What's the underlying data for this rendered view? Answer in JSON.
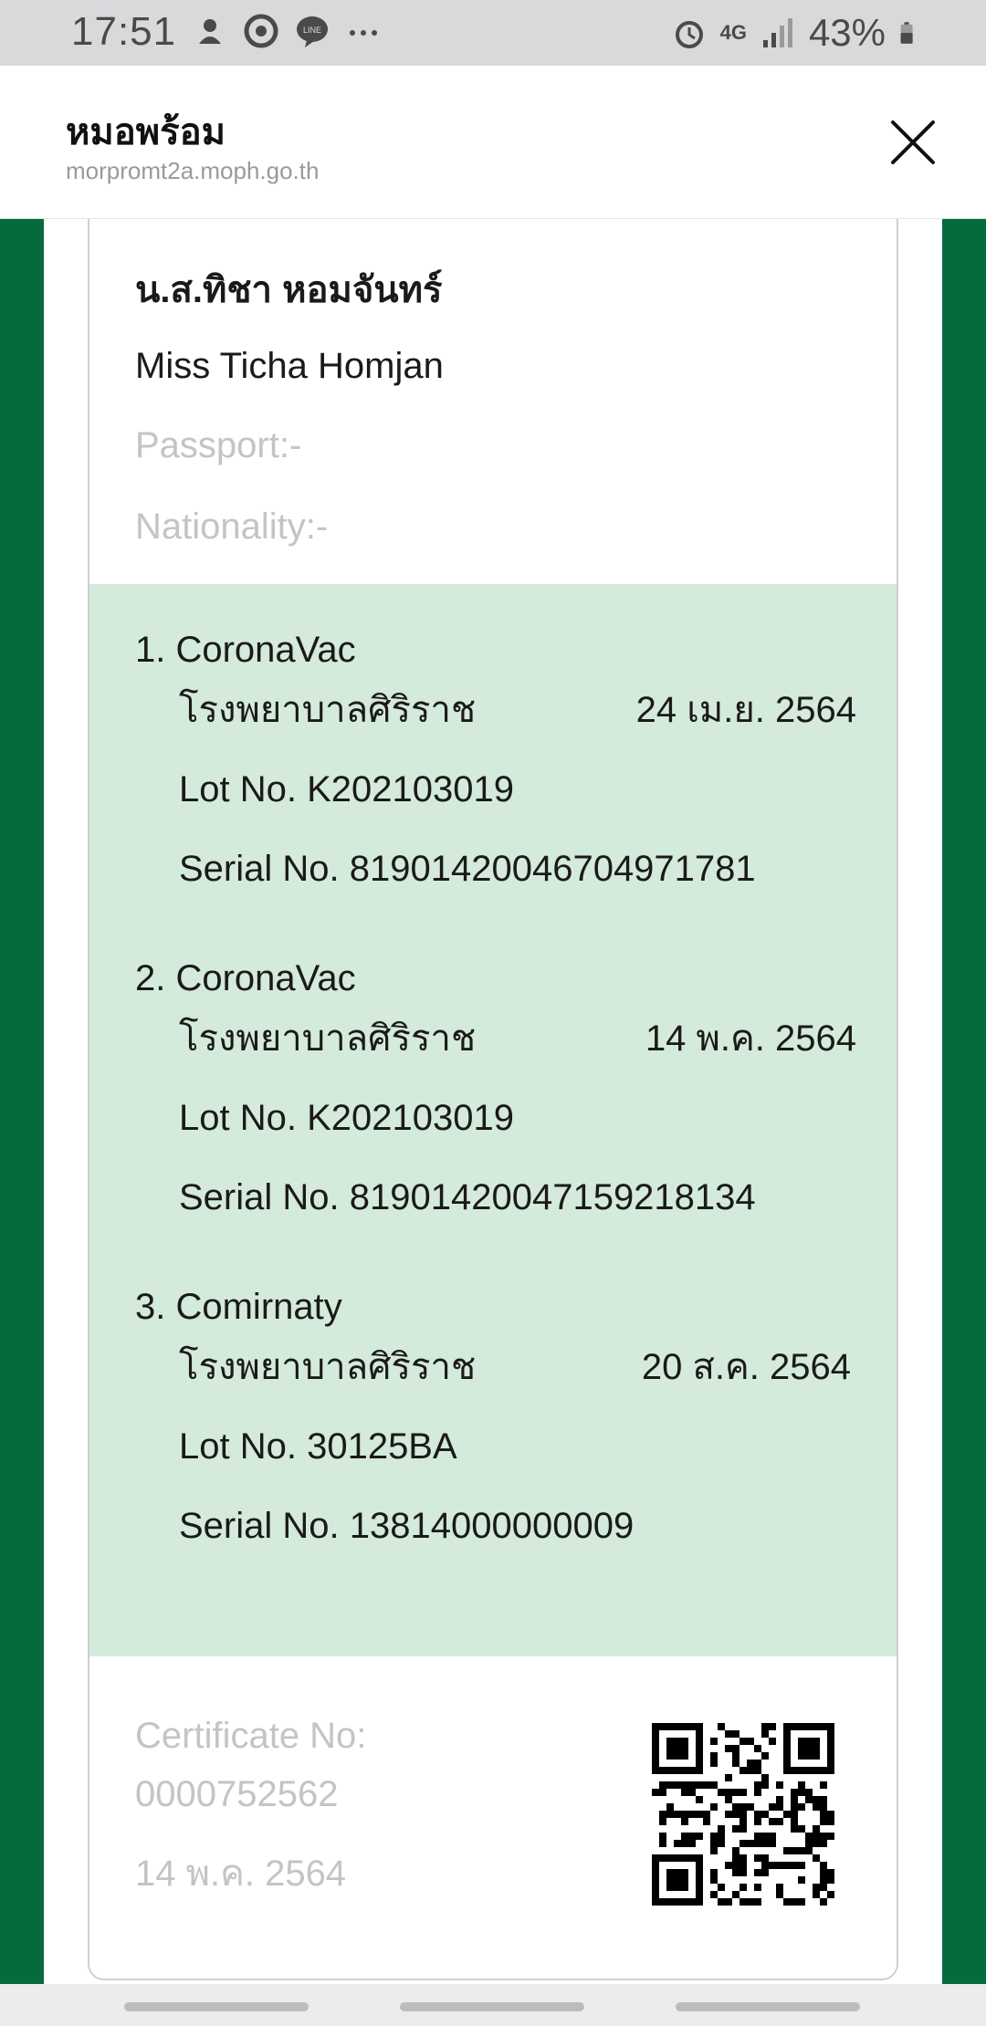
{
  "status_bar": {
    "time": "17:51",
    "network": "4G",
    "battery_percent": "43%",
    "left_icons": [
      "notification-icon",
      "chrome-icon",
      "line-icon",
      "more-icon"
    ],
    "right_icons": [
      "alarm-icon",
      "signal-icon",
      "battery-icon"
    ]
  },
  "header": {
    "title": "หมอพร้อม",
    "url": "morpromt2a.moph.go.th"
  },
  "person": {
    "name_th": "น.ส.ทิชา หอมจันทร์",
    "name_en": "Miss Ticha Homjan",
    "passport": "Passport:-",
    "nationality": "Nationality:-"
  },
  "doses": [
    {
      "title": "1. CoronaVac",
      "hospital": "โรงพยาบาลศิริราช",
      "date": "24 เม.ย. 2564",
      "lot": "Lot No. K202103019",
      "serial": "Serial No. 81901420046704971781"
    },
    {
      "title": "2. CoronaVac",
      "hospital": "โรงพยาบาลศิริราช",
      "date": "14 พ.ค. 2564",
      "lot": "Lot No. K202103019",
      "serial": "Serial No. 81901420047159218134"
    },
    {
      "title": "3. Comirnaty",
      "hospital": "โรงพยาบาลศิริราช",
      "date": "20 ส.ค. 2564",
      "lot": "Lot No. 30125BA",
      "serial": "Serial No. 13814000000009"
    }
  ],
  "certificate": {
    "label": "Certificate No:",
    "number": "0000752562",
    "date": "14 พ.ค. 2564"
  },
  "colors": {
    "brand_green": "#066a3b",
    "vaccine_bg": "#d4eada",
    "muted_text": "#c4c4c4"
  }
}
